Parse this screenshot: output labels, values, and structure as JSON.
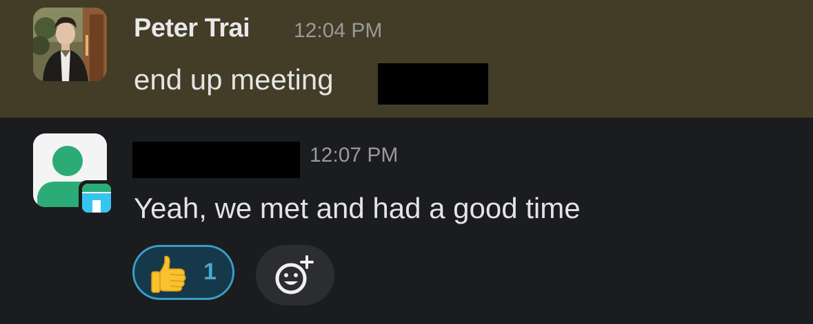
{
  "messages": [
    {
      "sender": "Peter Trai",
      "timestamp": "12:04 PM",
      "text": "end up meeting",
      "highlighted": true,
      "avatar": "profile-photo",
      "has_redaction": true
    },
    {
      "sender": "",
      "timestamp": "12:07 PM",
      "text": "Yeah, we met and had a good time",
      "avatar": "default-user-avatar",
      "app_badge": "workspace-app-badge",
      "sender_redacted": true,
      "reactions": [
        {
          "emoji": "thumbs-up-icon",
          "count": "1",
          "active": true
        }
      ],
      "add_reaction_icon": "add-emoji-icon"
    }
  ],
  "colors": {
    "highlight_bg": "#433c27",
    "background": "#1b1c1f",
    "reaction_border": "#3a9ec6",
    "reaction_count": "#4aa7d3",
    "avatar_green": "#2bac76",
    "badge_blue": "#36c5f0"
  }
}
